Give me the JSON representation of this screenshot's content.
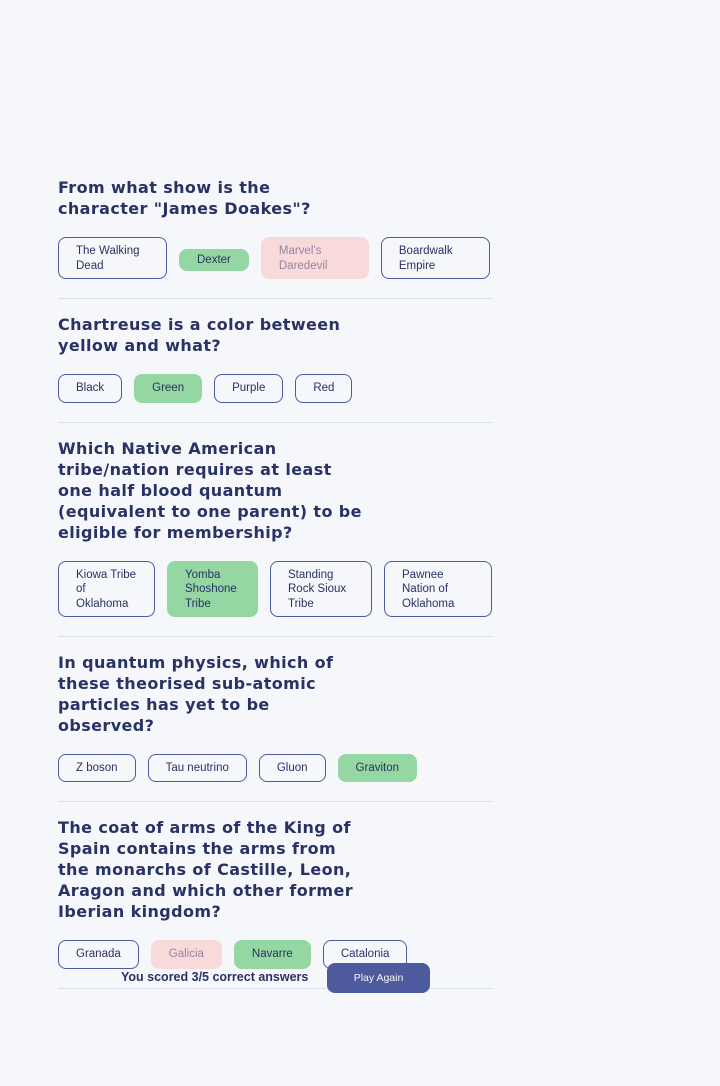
{
  "questions": [
    {
      "text": "From what show is the character \"James Doakes\"?",
      "answers": [
        {
          "label": "The Walking Dead",
          "state": "neutral"
        },
        {
          "label": "Dexter",
          "state": "correct"
        },
        {
          "label": "Marvel's Daredevil",
          "state": "wrong"
        },
        {
          "label": "Boardwalk Empire",
          "state": "neutral"
        }
      ]
    },
    {
      "text": "Chartreuse is a color between yellow and what?",
      "answers": [
        {
          "label": "Black",
          "state": "neutral"
        },
        {
          "label": "Green",
          "state": "correct"
        },
        {
          "label": "Purple",
          "state": "neutral"
        },
        {
          "label": "Red",
          "state": "neutral"
        }
      ]
    },
    {
      "text": "Which Native American tribe/nation requires at least one half blood quantum (equivalent to one parent) to be eligible for membership?",
      "answers": [
        {
          "label": "Kiowa Tribe of Oklahoma",
          "state": "neutral"
        },
        {
          "label": "Yomba Shoshone Tribe",
          "state": "correct"
        },
        {
          "label": "Standing Rock Sioux Tribe",
          "state": "neutral"
        },
        {
          "label": "Pawnee Nation of Oklahoma",
          "state": "neutral"
        }
      ]
    },
    {
      "text": "In quantum physics, which of these theorised sub-atomic particles has yet to be observed?",
      "answers": [
        {
          "label": "Z boson",
          "state": "neutral"
        },
        {
          "label": "Tau neutrino",
          "state": "neutral"
        },
        {
          "label": "Gluon",
          "state": "neutral"
        },
        {
          "label": "Graviton",
          "state": "correct"
        }
      ]
    },
    {
      "text": "The coat of arms of the King of Spain contains the arms from the monarchs of Castille, Leon, Aragon and which other former Iberian kingdom?",
      "answers": [
        {
          "label": "Granada",
          "state": "neutral"
        },
        {
          "label": "Galicia",
          "state": "wrong"
        },
        {
          "label": "Navarre",
          "state": "correct"
        },
        {
          "label": "Catalonia",
          "state": "neutral"
        }
      ]
    }
  ],
  "footer": {
    "score_text": "You scored 3/5 correct answers",
    "play_again_label": "Play Again"
  },
  "colors": {
    "background": "#f5f7fb",
    "text": "#293264",
    "accent": "#4d5b9e",
    "correct": "#94d7a2",
    "wrong": "#f8dadb"
  }
}
